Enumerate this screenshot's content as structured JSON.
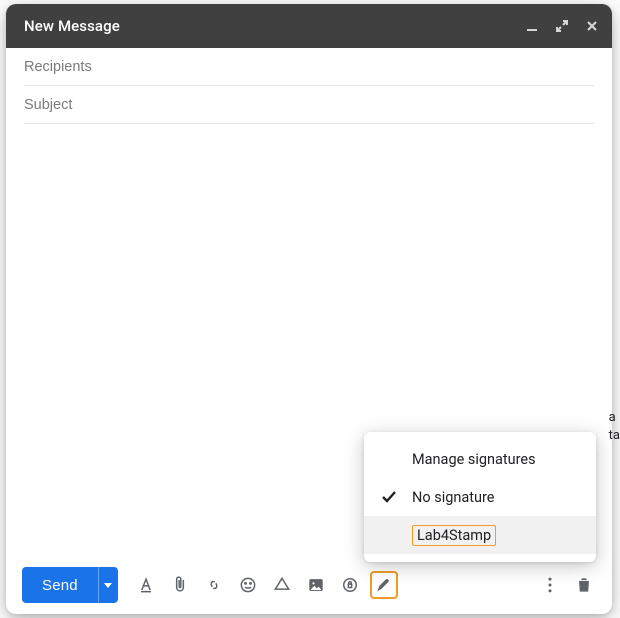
{
  "titlebar": {
    "title": "New Message"
  },
  "fields": {
    "recipients_placeholder": "Recipients",
    "recipients_value": "",
    "subject_placeholder": "Subject",
    "subject_value": ""
  },
  "footer": {
    "send_label": "Send"
  },
  "signature_menu": {
    "manage_label": "Manage signatures",
    "no_signature_label": "No signature",
    "items": [
      {
        "label": "Lab4Stamp"
      }
    ],
    "selected": "No signature"
  },
  "stray": {
    "line1": "a",
    "line2": "ta"
  }
}
